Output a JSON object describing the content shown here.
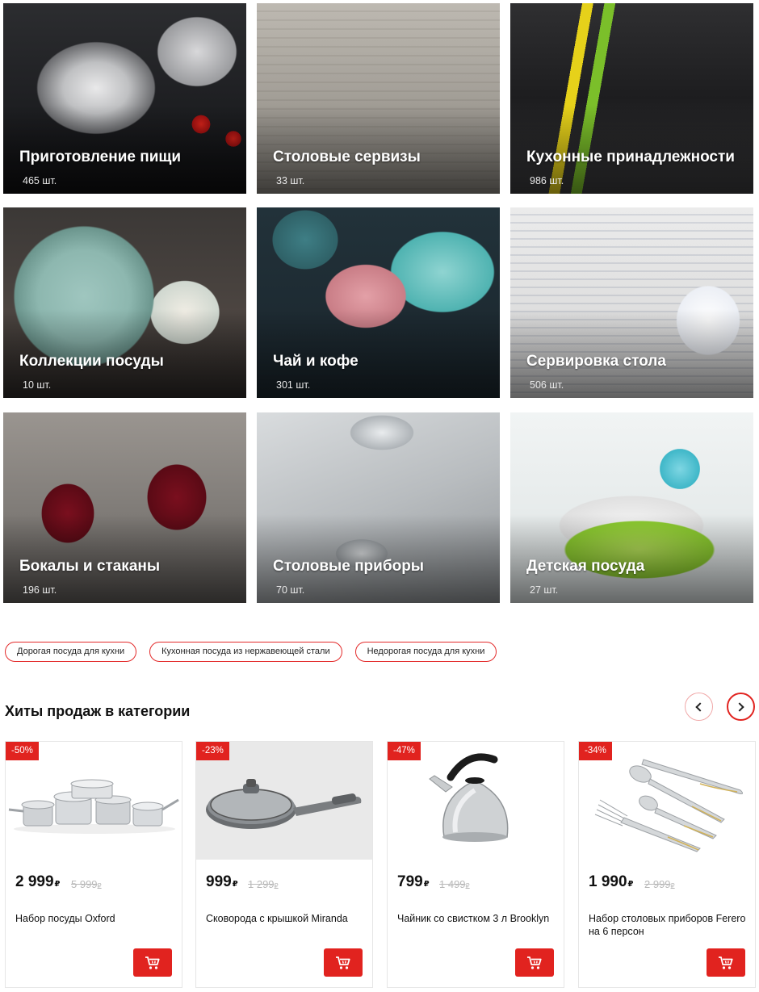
{
  "categories": [
    {
      "title": "Приготовление пищи",
      "count": "465 шт."
    },
    {
      "title": "Столовые сервизы",
      "count": "33 шт."
    },
    {
      "title": "Кухонные принадлежности",
      "count": "986 шт."
    },
    {
      "title": "Коллекции посуды",
      "count": "10 шт."
    },
    {
      "title": "Чай и кофе",
      "count": "301 шт."
    },
    {
      "title": "Сервировка стола",
      "count": "506 шт."
    },
    {
      "title": "Бокалы и стаканы",
      "count": "196 шт."
    },
    {
      "title": "Столовые приборы",
      "count": "70 шт."
    },
    {
      "title": "Детская посуда",
      "count": "27 шт."
    }
  ],
  "tags": [
    "Дорогая посуда для кухни",
    "Кухонная посуда из нержавеющей стали",
    "Недорогая посуда для кухни"
  ],
  "hits": {
    "title": "Хиты продаж в категории",
    "currency": "₽",
    "products": [
      {
        "discount": "-50%",
        "price": "2 999",
        "old_price": "5 999",
        "name": "Набор посуды Oxford"
      },
      {
        "discount": "-23%",
        "price": "999",
        "old_price": "1 299",
        "name": "Сковорода с крышкой Miranda"
      },
      {
        "discount": "-47%",
        "price": "799",
        "old_price": "1 499",
        "name": "Чайник со свистком 3 л Brooklyn"
      },
      {
        "discount": "-34%",
        "price": "1 990",
        "old_price": "2 999",
        "name": "Набор столовых приборов Ferero на 6 персон"
      }
    ]
  },
  "colors": {
    "accent": "#e1231f",
    "old_price": "#b8b8b8",
    "tag_border": "#e32a2a"
  }
}
